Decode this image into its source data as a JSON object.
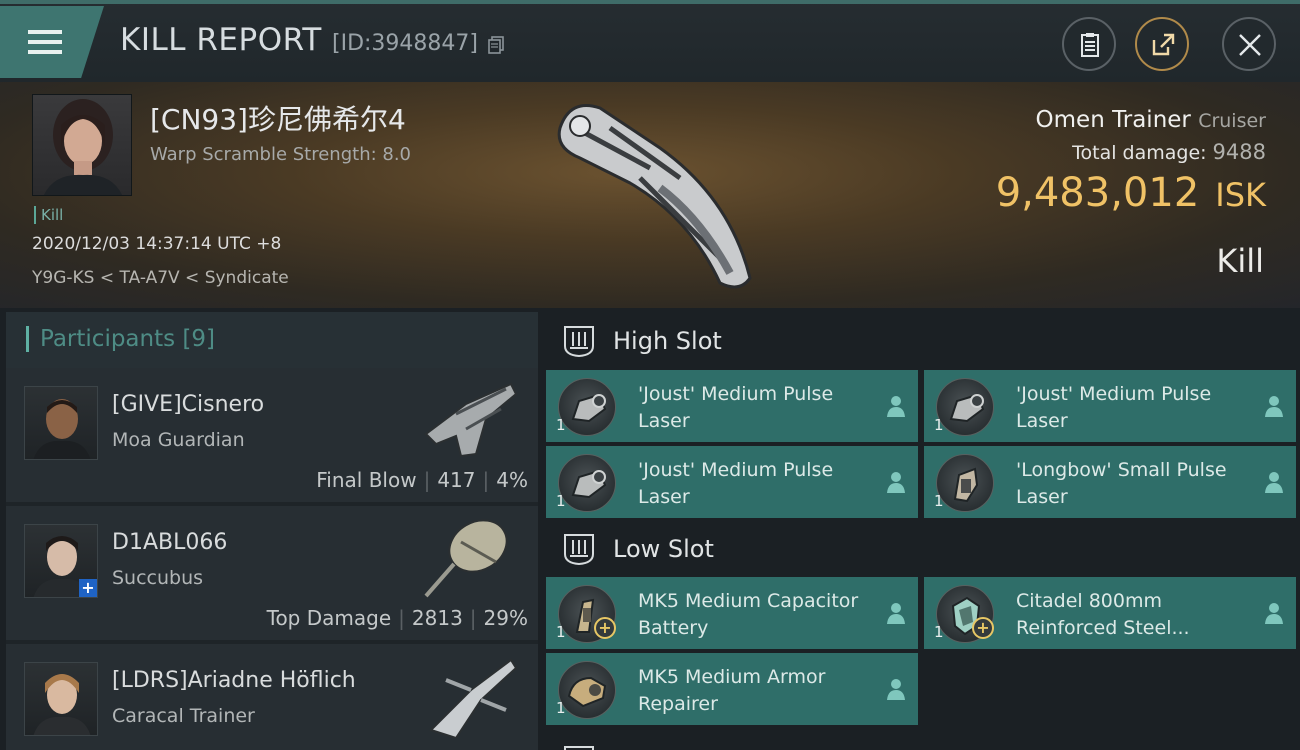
{
  "header": {
    "title": "KILL REPORT",
    "report_id": "[ID:3948847]"
  },
  "victim": {
    "name": "[CN93]珍尼佛希尔4",
    "warp_scramble": "Warp Scramble Strength: 8.0",
    "kill_tag": "Kill",
    "date": "2020/12/03 14:37:14 UTC +8",
    "location": "Y9G-KS < TA-A7V < Syndicate",
    "ship": "Omen Trainer",
    "ship_class": "Cruiser",
    "total_damage_label": "Total damage:",
    "total_damage": "9488",
    "isk_value": "9,483,012",
    "isk_unit": "ISK",
    "result": "Kill"
  },
  "participants": {
    "title": "Participants",
    "count": "[9]",
    "rows": [
      {
        "name": "[GIVE]Cisnero",
        "ship": "Moa Guardian",
        "role": "Final Blow",
        "damage": "417",
        "percent": "4%"
      },
      {
        "name": "D1ABL066",
        "ship": "Succubus",
        "role": "Top Damage",
        "damage": "2813",
        "percent": "29%"
      },
      {
        "name": "[LDRS]Ariadne Höflich",
        "ship": "Caracal Trainer"
      }
    ]
  },
  "slots": {
    "high": {
      "label": "High Slot",
      "modules": [
        {
          "qty": "1",
          "name": "'Joust' Medium Pulse Laser"
        },
        {
          "qty": "1",
          "name": "'Joust' Medium Pulse Laser"
        },
        {
          "qty": "1",
          "name": "'Joust' Medium Pulse Laser"
        },
        {
          "qty": "1",
          "name": "'Longbow' Small Pulse Laser"
        }
      ]
    },
    "low": {
      "label": "Low Slot",
      "modules": [
        {
          "qty": "1",
          "name": "MK5 Medium Capacitor Battery"
        },
        {
          "qty": "1",
          "name": "Citadel 800mm Reinforced Steel..."
        },
        {
          "qty": "1",
          "name": "MK5 Medium Armor Repairer"
        }
      ]
    }
  },
  "colors": {
    "accent": "#3e7570",
    "module_bg": "#2f6e69",
    "isk": "#f0c266"
  }
}
